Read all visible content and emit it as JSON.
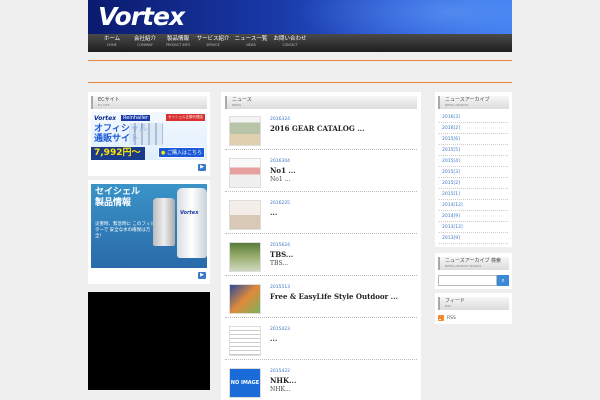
{
  "header": {
    "logo": "Vortex"
  },
  "nav": [
    {
      "jp": "ホーム",
      "en": "HOME"
    },
    {
      "jp": "会社紹介",
      "en": "COMPANY"
    },
    {
      "jp": "製品情報",
      "en": "PRODUCT INFO"
    },
    {
      "jp": "サービス紹介",
      "en": "SERVICE"
    },
    {
      "jp": "ニュース一覧",
      "en": "NEWS"
    },
    {
      "jp": "お問い合わせ",
      "en": "CONTACT"
    }
  ],
  "left": {
    "ec_title": "ECサイト",
    "ec_sub": "EC SITE",
    "ad1": {
      "brand": "Vortex",
      "brand2": "Reinhaller",
      "badge": "セイシェル正規代理店",
      "main_line1": "オフィシャル",
      "main_line2": "通販サイト",
      "price": "7,992円〜",
      "buy": "ご購入はこちら"
    },
    "ad2": {
      "title_line1": "セイシェル",
      "title_line2": "製品情報",
      "desc": "災害時、緊急時に このフィルターで 安全な水の確保は万全!"
    }
  },
  "center": {
    "title": "ニュース",
    "sub": "NEWS",
    "items": [
      {
        "date": "2016324",
        "title": "2016 GEAR CATALOG ...",
        "excerpt": ""
      },
      {
        "date": "2016304",
        "title": "No1 ...",
        "excerpt": "No1 ..."
      },
      {
        "date": "2016225",
        "title": "...",
        "excerpt": ""
      },
      {
        "date": "2015624",
        "title": "TBS...",
        "excerpt": "TBS..."
      },
      {
        "date": "2015513",
        "title": "Free & EasyLife Style Outdoor ...",
        "excerpt": ""
      },
      {
        "date": "2015423",
        "title": "...",
        "excerpt": ""
      },
      {
        "date": "2015422",
        "title": "NHK...",
        "excerpt": "NHK...",
        "noimage": "NO IMAGE"
      }
    ]
  },
  "right": {
    "archive_title": "ニュースアーカイブ",
    "archive_sub": "NEWS ARCHIVE",
    "archive": [
      "2016[3]",
      "2016[2]",
      "2015[6]",
      "2015[5]",
      "2015[4]",
      "2015[3]",
      "2015[2]",
      "2015[1]",
      "2014[12]",
      "2014[9]",
      "2013[12]",
      "2013[9]"
    ],
    "search_title": "ニュースアーカイブ 検索",
    "search_sub": "NEWS ARCHIVE SEARCH",
    "feed_title": "フィード",
    "feed_sub": "RSS",
    "rss_label": "RSS"
  },
  "colors": {
    "accent": "#3a78c8",
    "orange": "#e8853a",
    "nav_bg": "#2a2a2a"
  }
}
